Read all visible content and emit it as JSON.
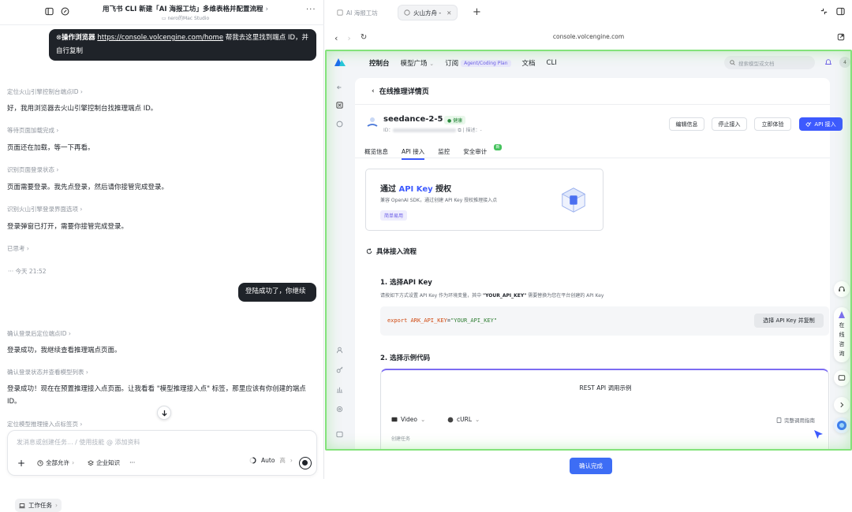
{
  "chat": {
    "title": "用飞书 CLI 新建「AI 海报工坊」多维表格并配置流程",
    "title_chevron": "›",
    "subtitle": "nero的Mac Studio",
    "more": "···",
    "messages": [
      {
        "type": "user_browser",
        "prefix": "操作浏览器",
        "link": "https://console.volcengine.com/home",
        "text": " 帮我去这里找到端点 ID，并自行复制"
      },
      {
        "type": "step",
        "text": "定位火山引擎控制台端点ID ›"
      },
      {
        "type": "assistant",
        "text": "好，我用浏览器去火山引擎控制台找推理端点 ID。"
      },
      {
        "type": "step",
        "text": "等待页面加载完成 ›"
      },
      {
        "type": "assistant",
        "text": "页面还在加载，等一下再看。"
      },
      {
        "type": "step",
        "text": "识别页面登录状态 ›"
      },
      {
        "type": "assistant",
        "text": "页面需要登录。我先点登录，然后请你接管完成登录。"
      },
      {
        "type": "step",
        "text": "识别火山引擎登录界面选项 ›"
      },
      {
        "type": "assistant",
        "text": "登录弹窗已打开，需要你接管完成登录。"
      },
      {
        "type": "step",
        "text": "已思考 ›"
      },
      {
        "type": "timestamp",
        "text": "···  今天 21:52"
      },
      {
        "type": "user",
        "text": "登陆成功了，你继续"
      },
      {
        "type": "step",
        "text": "确认登录后定位端点ID ›"
      },
      {
        "type": "assistant",
        "text": "登录成功，我继续查看推理端点页面。"
      },
      {
        "type": "step",
        "text": "确认登录状态并查看模型列表 ›"
      },
      {
        "type": "assistant",
        "text": "登录成功！现在在预置推理接入点页面。让我看看 \"模型推理接入点\" 标签，那里应该有你创建的端点 ID。"
      },
      {
        "type": "step",
        "text": "定位模型推理接入点标签页 ›"
      }
    ],
    "composer": {
      "placeholder": "发消息或创建任务... / 使用技能 @ 添加资料",
      "plus": "+",
      "task_chip": "工作任务",
      "perm_chip": "全部允许",
      "knowledge_chip": "企业知识",
      "more": "···",
      "mode": "Auto",
      "mode_level": "高"
    }
  },
  "browser": {
    "tabs": [
      {
        "label": "AI 海报工坊",
        "active": false
      },
      {
        "label": "火山方舟 -",
        "active": true
      }
    ],
    "new_tab": "+",
    "url": "console.volcengine.com",
    "nav": {
      "back": "‹",
      "forward": "›",
      "reload": "↻"
    },
    "confirm_label": "确认完成"
  },
  "console": {
    "nav": {
      "items": [
        "控制台",
        "模型广场",
        "订阅",
        "文档",
        "CLI"
      ],
      "plan_tag": "Agent/Coding Plan",
      "search_placeholder": "搜索模型或文档",
      "badge": "4"
    },
    "page_title": "在线推理详情页",
    "model": {
      "name": "seedance-2-5",
      "status": "健康",
      "id_label": "ID：",
      "desc_label": "描述：-"
    },
    "actions": [
      "编辑信息",
      "停止接入",
      "立即体验",
      "API 接入"
    ],
    "tabs": [
      "概览信息",
      "API 接入",
      "监控",
      "安全审计"
    ],
    "tab_badge": "新",
    "auth_card": {
      "title_pre": "通过 ",
      "title_em": "API Key",
      "title_post": " 授权",
      "desc": "兼容 OpenAI SDK，通过创建 API Key 授权推理接入点",
      "tag": "简单易用"
    },
    "flow_title": "具体接入流程",
    "step1": {
      "title": "1. 选择API Key",
      "desc_pre": "请按如下方式设置 API Key 作为环境变量，其中 ",
      "desc_key": "\"YOUR_API_KEY\"",
      "desc_post": " 需要替换为您在平台创建的 API Key",
      "code_export": "export",
      "code_var": "ARK_API_KEY",
      "code_eq": "=",
      "code_val": "\"YOUR_API_KEY\"",
      "copy_button": "选择 API Key 并复制"
    },
    "step2": {
      "title": "2. 选择示例代码",
      "card_title": "REST API 调用示例",
      "select_video": "Video",
      "select_curl": "cURL",
      "guide": "完整调用指南",
      "create_task": "创建任务"
    },
    "side_consult": [
      "在",
      "线",
      "咨",
      "询"
    ]
  },
  "colors": {
    "accent": "#3d5afe",
    "highlight": "#83e27a",
    "dark_bubble": "#1f2329"
  }
}
